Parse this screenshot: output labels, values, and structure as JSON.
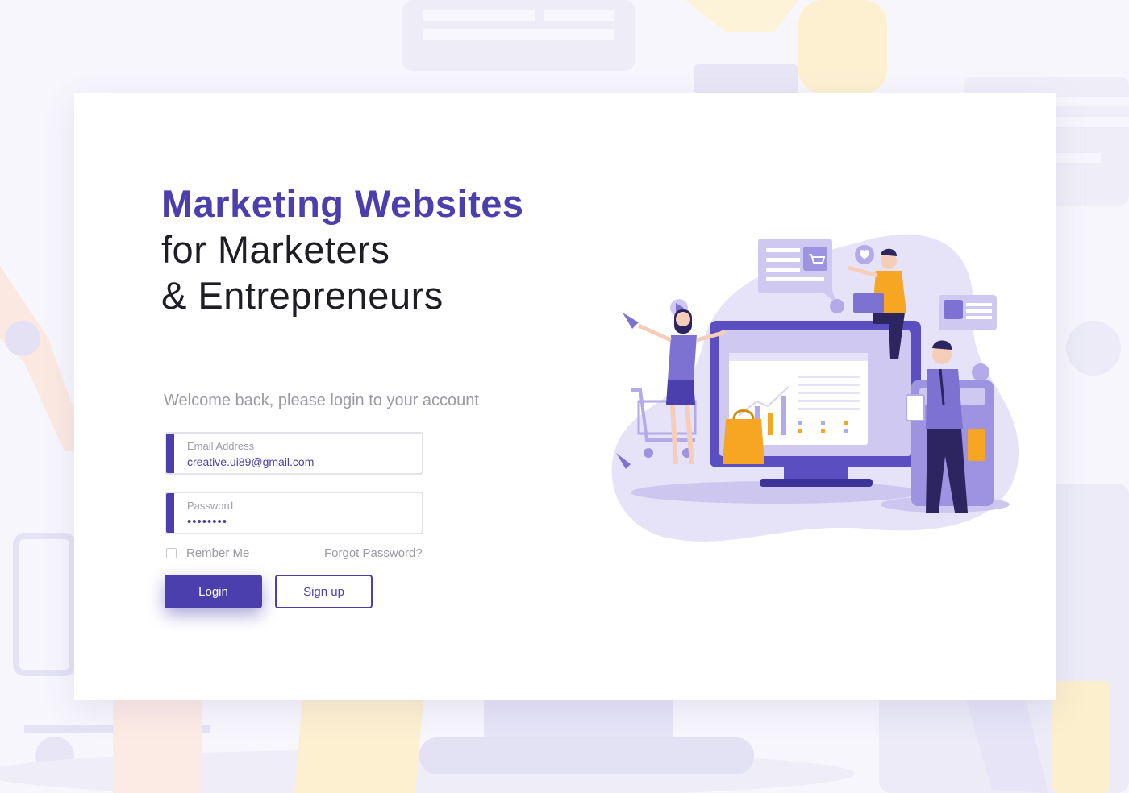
{
  "headline": {
    "line1": "Marketing Websites",
    "line2": "for Marketers",
    "line3": "& Entrepreneurs"
  },
  "login": {
    "welcome": "Welcome back, please login to your account",
    "email_label": "Email Address",
    "email_value": "creative.ui89@gmail.com",
    "password_label": "Password",
    "password_mask": "••••••••",
    "remember_label": "Rember Me",
    "remember_checked": false,
    "forgot_label": "Forgot Password?",
    "login_button": "Login",
    "signup_button": "Sign up"
  },
  "theme": {
    "primary": "#4b3fae",
    "accent": "#f6a623",
    "light_purple": "#e6e2f8"
  },
  "illustration": {
    "icons": [
      "cart-icon",
      "heart-icon",
      "play-icon",
      "like-icon",
      "megaphone-icon",
      "shopping-bag-icon",
      "calculator-icon",
      "bar-chart-icon"
    ]
  }
}
